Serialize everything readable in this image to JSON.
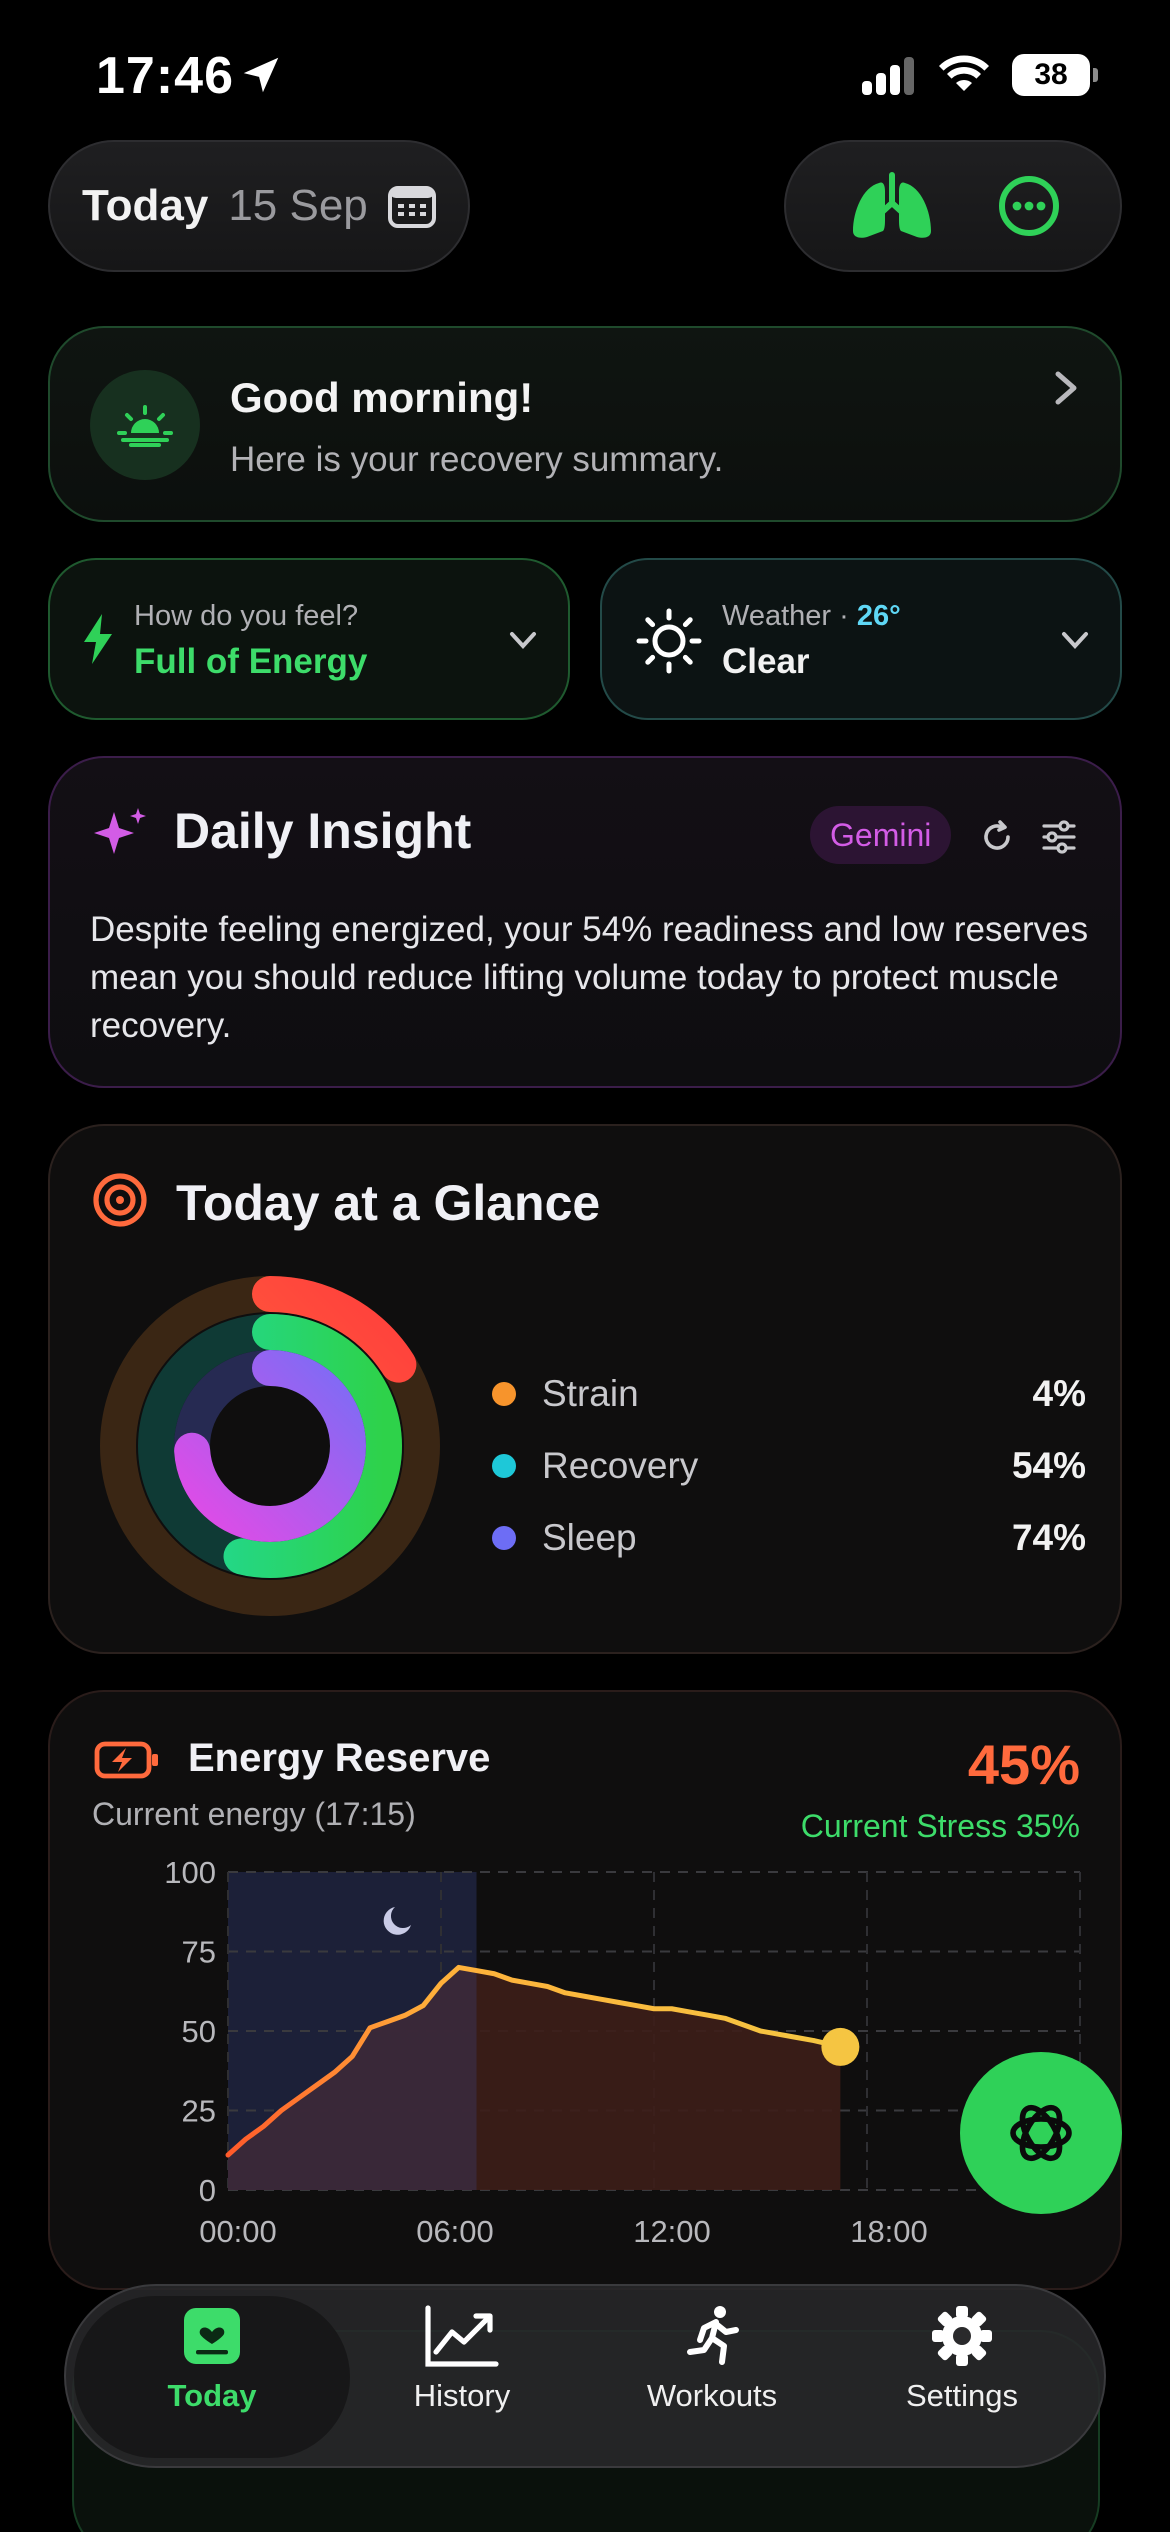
{
  "status_bar": {
    "time": "17:46",
    "battery": "38"
  },
  "header": {
    "today_label": "Today",
    "date": "15 Sep"
  },
  "greeting": {
    "title": "Good morning!",
    "subtitle": "Here is your recovery summary."
  },
  "feel": {
    "label": "How do you feel?",
    "value": "Full of Energy"
  },
  "weather": {
    "label": "Weather",
    "separator": "·",
    "temp": "26°",
    "condition": "Clear"
  },
  "insight": {
    "title": "Daily Insight",
    "badge": "Gemini",
    "text": "Despite feeling energized, your 54% readiness and low reserves mean you should reduce lifting volume today to protect muscle recovery."
  },
  "glance": {
    "title": "Today at a Glance",
    "items": [
      {
        "label": "Strain",
        "value": "4%",
        "fraction": 0.04,
        "color": "#f7942c"
      },
      {
        "label": "Recovery",
        "value": "54%",
        "fraction": 0.54,
        "color": "#1ec8d8"
      },
      {
        "label": "Sleep",
        "value": "74%",
        "fraction": 0.74,
        "color": "#6d6df5"
      }
    ]
  },
  "energy": {
    "title": "Energy Reserve",
    "subtitle": "Current energy (17:15)",
    "percent": "45%",
    "stress": "Current Stress 35%"
  },
  "chart_data": {
    "type": "area",
    "y_ticks": [
      "100",
      "75",
      "50",
      "25",
      "0"
    ],
    "x_ticks": [
      "00:00",
      "06:00",
      "12:00",
      "18:00"
    ],
    "ylim": [
      0,
      100
    ],
    "xlim": [
      0,
      24
    ],
    "sleep_window": [
      0,
      7
    ],
    "series": [
      {
        "x": [
          0,
          0.5,
          1,
          1.5,
          2,
          2.5,
          3,
          3.5,
          4,
          4.5,
          5,
          5.5,
          6,
          6.5,
          7,
          7.5,
          8,
          8.5,
          9,
          9.5,
          10,
          10.5,
          11,
          11.5,
          12,
          12.5,
          13,
          13.5,
          14,
          14.5,
          15,
          15.5,
          16,
          16.5,
          17.25
        ],
        "y": [
          11,
          16,
          20,
          25,
          29,
          33,
          37,
          42,
          51,
          53,
          55,
          58,
          65,
          70,
          69,
          68,
          66,
          65,
          64,
          62,
          61,
          60,
          59,
          58,
          57,
          57,
          56,
          55,
          54,
          52,
          50,
          49,
          48,
          47,
          45
        ]
      }
    ],
    "projection": {
      "x": [
        16.5,
        17.25
      ],
      "y": [
        47,
        45
      ]
    }
  },
  "tabs": [
    {
      "label": "Today",
      "icon": "today-icon"
    },
    {
      "label": "History",
      "icon": "history-chart-icon"
    },
    {
      "label": "Workouts",
      "icon": "running-icon"
    },
    {
      "label": "Settings",
      "icon": "gear-icon"
    }
  ],
  "colors": {
    "accent": "#3ddc6a",
    "energy": "#ff6a3d",
    "insight": "#d35ce6"
  }
}
